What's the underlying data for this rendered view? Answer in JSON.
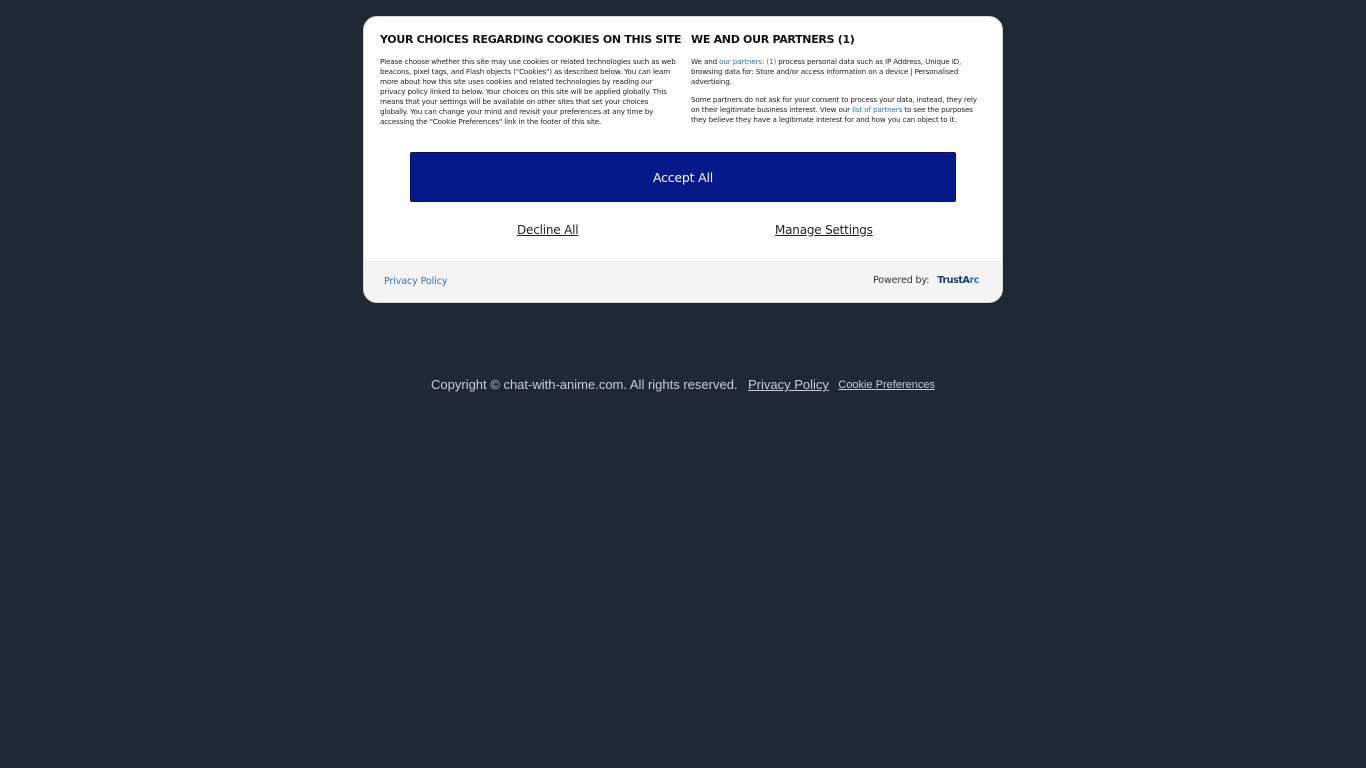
{
  "consent": {
    "left_title": "YOUR CHOICES REGARDING COOKIES ON THIS SITE",
    "left_body": "Please choose whether this site may use cookies or related technologies such as web beacons, pixel tags, and Flash objects (\"Cookies\") as described below. You can learn more about how this site uses cookies and related technologies by reading our privacy policy linked to below. Your choices on this site will be applied globally. This means that your settings will be available on other sites that set your choices globally. You can change your mind and revisit your preferences at any time by accessing the \"Cookie Preferences\" link in the footer of this site.",
    "right_title": "WE AND OUR PARTNERS (1)",
    "right_p1_pre": "We and ",
    "right_p1_link": "our partners: (1)",
    "right_p1_post": " process personal data such as IP Address, Unique ID, browsing data for: Store and/or access information on a device | Personalised advertising.",
    "right_p2_pre": "Some partners do not ask for your consent to process your data, instead, they rely on their legitimate business interest. View our ",
    "right_p2_link": "list of partners",
    "right_p2_post": " to see the purposes they believe they have a legitimate interest for and how you can object to it.",
    "accept_label": "Accept All",
    "decline_label": "Decline All",
    "manage_label": "Manage Settings",
    "privacy_link": "Privacy Policy",
    "powered_label": "Powered by:",
    "logo_text_main": "TrustA",
    "logo_text_accent": "rc"
  },
  "site_footer": {
    "copyright": "Copyright © chat-with-anime.com.  All rights reserved.",
    "privacy_link": "Privacy Policy",
    "cookie_prefs": "Cookie Preferences"
  },
  "colors": {
    "page_bg": "#1f2933",
    "accept_bg": "#06198a",
    "link": "#2d72b5"
  }
}
